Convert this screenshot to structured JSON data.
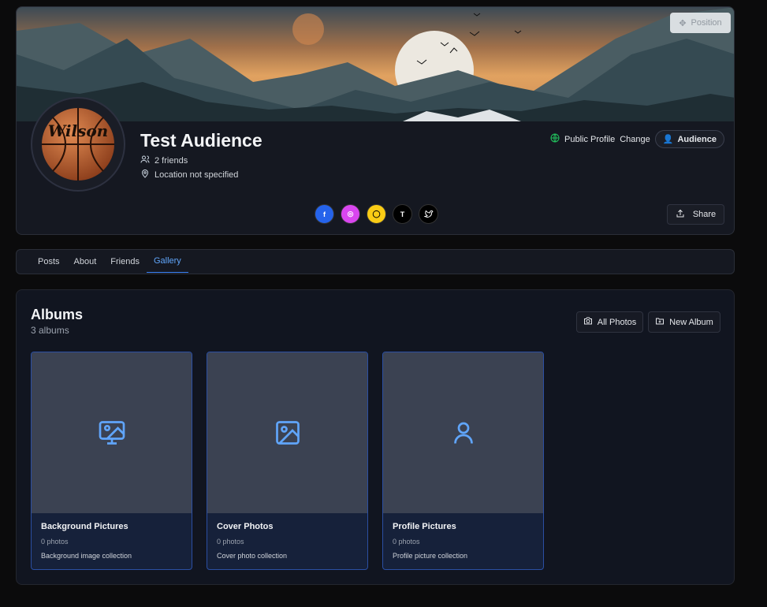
{
  "cover": {
    "position_label": "Position"
  },
  "profile": {
    "name": "Test Audience",
    "friends": "2 friends",
    "location": "Location not specified",
    "visibility_label": "Public Profile",
    "change_label": "Change",
    "audience_label": "Audience",
    "share_label": "Share",
    "avatar_text": "Wilson"
  },
  "socials": [
    {
      "name": "facebook",
      "glyph": "f",
      "color": "#2563eb"
    },
    {
      "name": "instagram",
      "glyph": "◎",
      "color": "#d946ef"
    },
    {
      "name": "snapchat",
      "glyph": "◯",
      "color": "#facc15"
    },
    {
      "name": "threads",
      "glyph": "T",
      "color": "#000000"
    },
    {
      "name": "twitter",
      "glyph": "🐦",
      "color": "#000000"
    }
  ],
  "tabs": [
    {
      "label": "Posts"
    },
    {
      "label": "About"
    },
    {
      "label": "Friends"
    },
    {
      "label": "Gallery",
      "active": true
    }
  ],
  "albums_section": {
    "title": "Albums",
    "count": "3 albums",
    "all_photos_label": "All Photos",
    "new_album_label": "New Album"
  },
  "albums": [
    {
      "title": "Background Pictures",
      "count": "0 photos",
      "description": "Background image collection",
      "icon": "image-monitor-icon"
    },
    {
      "title": "Cover Photos",
      "count": "0 photos",
      "description": "Cover photo collection",
      "icon": "image-icon"
    },
    {
      "title": "Profile Pictures",
      "count": "0 photos",
      "description": "Profile picture collection",
      "icon": "user-icon"
    }
  ],
  "colors": {
    "accent": "#3b82f6",
    "tab_active": "#60a5fa",
    "card_border": "#2b4fa3"
  }
}
